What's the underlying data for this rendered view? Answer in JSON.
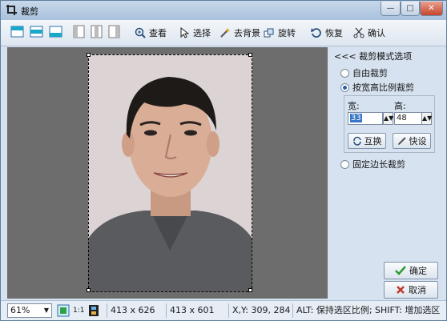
{
  "window": {
    "title": "裁剪"
  },
  "toolbar": {
    "view_label": "查看",
    "select_label": "选择",
    "remove_bg_label": "去背景",
    "rotate_label": "旋转",
    "restore_label": "恢复",
    "confirm_label": "确认"
  },
  "panel": {
    "title": "<<< 裁剪模式选项",
    "mode_free": "自由裁剪",
    "mode_ratio": "按宽高比例裁剪",
    "width_label": "宽:",
    "height_label": "高:",
    "width_value": "33",
    "height_value": "48",
    "swap_label": "互换",
    "preset_label": "快设",
    "mode_fixed": "固定边长裁剪",
    "ok_label": "确定",
    "cancel_label": "取消"
  },
  "statusbar": {
    "zoom": "61%",
    "one_to_one": "1:1",
    "image_size": "413 x 626",
    "selection_size": "413 x 601",
    "cursor": "X,Y: 309, 284",
    "hint": "ALT: 保持选区比例;  SHIFT: 增加选区"
  },
  "colors": {
    "canvas_bg": "#6d6d6d",
    "accent": "#2a5fb0",
    "confirm_green": "#2f9a2f",
    "cancel_red": "#c0392b"
  }
}
